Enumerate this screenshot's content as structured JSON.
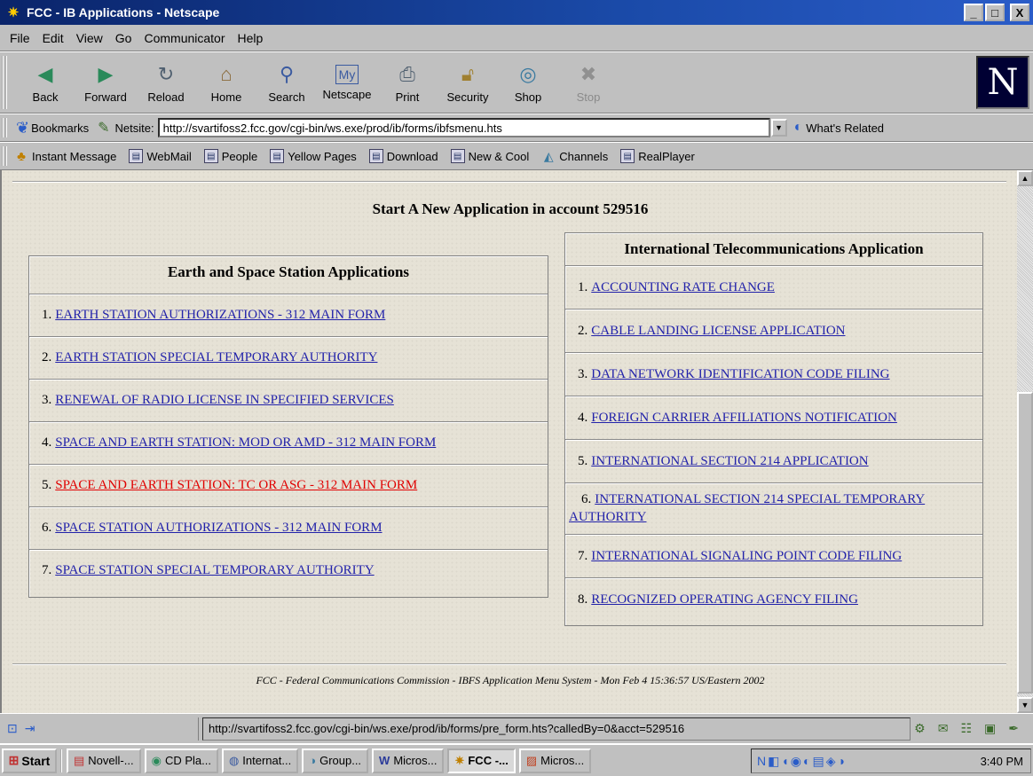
{
  "window": {
    "title": "FCC - IB Applications - Netscape",
    "minimize": "_",
    "maximize": "□",
    "close": "X"
  },
  "menu": [
    "File",
    "Edit",
    "View",
    "Go",
    "Communicator",
    "Help"
  ],
  "nav": [
    {
      "label": "Back",
      "icon": "back-icon"
    },
    {
      "label": "Forward",
      "icon": "forward-icon"
    },
    {
      "label": "Reload",
      "icon": "reload-icon"
    },
    {
      "label": "Home",
      "icon": "home-icon"
    },
    {
      "label": "Search",
      "icon": "search-icon"
    },
    {
      "label": "Netscape",
      "icon": "netscape-icon"
    },
    {
      "label": "Print",
      "icon": "print-icon"
    },
    {
      "label": "Security",
      "icon": "security-icon"
    },
    {
      "label": "Shop",
      "icon": "shop-icon"
    },
    {
      "label": "Stop",
      "icon": "stop-icon"
    }
  ],
  "location": {
    "bookmarks": "Bookmarks",
    "netsite_label": "Netsite:",
    "url": "http://svartifoss2.fcc.gov/cgi-bin/ws.exe/prod/ib/forms/ibfsmenu.hts",
    "whats_related": "What's Related"
  },
  "personal": [
    "Instant Message",
    "WebMail",
    "People",
    "Yellow Pages",
    "Download",
    "New & Cool",
    "Channels",
    "RealPlayer"
  ],
  "page": {
    "heading": "Start A New Application in account 529516",
    "left_panel": {
      "title": "Earth and Space Station Applications",
      "items": [
        {
          "num": "1.",
          "label": "EARTH STATION AUTHORIZATIONS - 312 MAIN FORM"
        },
        {
          "num": "2.",
          "label": "EARTH STATION SPECIAL TEMPORARY AUTHORITY"
        },
        {
          "num": "3.",
          "label": "RENEWAL OF RADIO LICENSE IN SPECIFIED SERVICES"
        },
        {
          "num": "4.",
          "label": "SPACE AND EARTH STATION: MOD OR AMD - 312 MAIN FORM"
        },
        {
          "num": "5.",
          "label": "SPACE AND EARTH STATION: TC OR ASG - 312 MAIN FORM"
        },
        {
          "num": "6.",
          "label": "SPACE STATION AUTHORIZATIONS - 312 MAIN FORM"
        },
        {
          "num": "7.",
          "label": "SPACE STATION SPECIAL TEMPORARY AUTHORITY"
        }
      ]
    },
    "right_panel": {
      "title": "International Telecommunications Application",
      "items": [
        {
          "num": "1.",
          "label": "ACCOUNTING RATE CHANGE"
        },
        {
          "num": "2.",
          "label": "CABLE LANDING LICENSE APPLICATION"
        },
        {
          "num": "3.",
          "label": "DATA NETWORK IDENTIFICATION CODE FILING"
        },
        {
          "num": "4.",
          "label": "FOREIGN CARRIER AFFILIATIONS NOTIFICATION"
        },
        {
          "num": "5.",
          "label": "INTERNATIONAL SECTION 214 APPLICATION"
        },
        {
          "num": "6.",
          "label": "INTERNATIONAL SECTION 214 SPECIAL TEMPORARY AUTHORITY"
        },
        {
          "num": "7.",
          "label": "INTERNATIONAL SIGNALING POINT CODE FILING"
        },
        {
          "num": "8.",
          "label": "RECOGNIZED OPERATING AGENCY FILING"
        }
      ]
    },
    "footer": "FCC - Federal Communications Commission - IBFS Application Menu System - Mon Feb 4 15:36:57 US/Eastern 2002"
  },
  "status": {
    "text": "http://svartifoss2.fcc.gov/cgi-bin/ws.exe/prod/ib/forms/pre_form.hts?calledBy=0&acct=529516"
  },
  "taskbar": {
    "start": "Start",
    "tasks": [
      "Novell-...",
      "CD Pla...",
      "Internat...",
      "Group...",
      "Micros...",
      "FCC -...",
      "Micros..."
    ],
    "clock": "3:40 PM"
  },
  "colors": {
    "link": "#2222aa",
    "active_link": "#e00000",
    "titlebar": "#0a246a"
  }
}
